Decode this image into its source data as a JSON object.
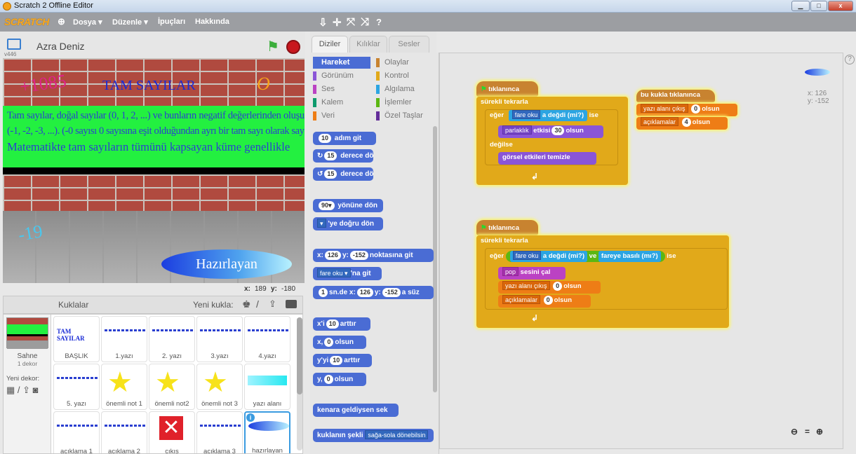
{
  "window": {
    "title": "Scratch 2 Offline Editor",
    "min": "▁",
    "max": "□",
    "close": "x"
  },
  "menubar": {
    "logo": "SCRATCH",
    "globe": "⊕",
    "items": [
      "Dosya ▾",
      "Düzenle ▾",
      "İpuçları",
      "Hakkında"
    ],
    "tools": [
      "⇩",
      "✛",
      "⤧",
      "⤨",
      "?"
    ]
  },
  "stage": {
    "sprite_name": "Azra Deniz",
    "version": "v446",
    "green_flag": "⚑",
    "stop": "●",
    "score": "+1085",
    "title": "TAM SAYILAR",
    "o_letter": "O",
    "text_lines": [
      "Tam sayılar, doğal sayılar (0, 1, 2, ...) ve bunların negatif değerlerinden oluşur",
      "(-1, -2, -3, ...). (-0 sayısı 0 sayısına eşit olduğundan ayrı bir tam sayı olarak sayılmaz)",
      "Matematikte tam sayıların tümünü kapsayan küme genellikle"
    ],
    "minus": "-19",
    "button": "Hazırlayan",
    "x_label": "x:",
    "x_val": "189",
    "y_label": "y:",
    "y_val": "-180"
  },
  "sprites": {
    "header": "Kuklalar",
    "new_sprite": "Yeni kukla:",
    "stage_label": "Sahne",
    "stage_sub": "1 dekor",
    "new_backdrop": "Yeni dekor:",
    "items": [
      "BAŞLIK",
      "1.yazı",
      "2. yazı",
      "3.yazı",
      "4.yazı",
      "5. yazı",
      "önemli not 1",
      "önemli not2",
      "önemli not 3",
      "yazı alanı",
      "açıklama 1",
      "açıklama 2",
      "çıkış",
      "açıklama 3",
      "hazırlayan"
    ]
  },
  "tabs": [
    "Diziler",
    "Kılıklar",
    "Sesler"
  ],
  "categories": {
    "left": [
      "Hareket",
      "Görünüm",
      "Ses",
      "Kalem",
      "Veri"
    ],
    "right": [
      "Olaylar",
      "Kontrol",
      "Algılama",
      "İşlemler",
      "Özel Taşlar"
    ],
    "left_colors": [
      "#4a6cd4",
      "#8a55d7",
      "#bb42c3",
      "#0e9a6c",
      "#ee7d16"
    ],
    "right_colors": [
      "#c88330",
      "#e1a91a",
      "#2ca5e2",
      "#5cb712",
      "#632d99"
    ]
  },
  "palette": {
    "move": "adım git",
    "move_n": "10",
    "turn_r": "derece dön",
    "turn_n": "15",
    "turn_l": "derece dön",
    "turn_l_n": "15",
    "point_dir": "yönüne dön",
    "dir_n": "90▾",
    "point_to": "'ye doğru dön",
    "goto_xy_x": "x:",
    "goto_x": "126",
    "goto_y_lbl": "y:",
    "goto_y": "-152",
    "goto_xy": "noktasına git",
    "goto": "fare oku ▾",
    "goto_suffix": "'na git",
    "glide_n": "1",
    "glide": "sn.de x:",
    "glide_x": "126",
    "glide_y_lbl": "y:",
    "glide_y": "-152",
    "glide_suffix": "a süz",
    "change_x": "x'i",
    "change_x_n": "10",
    "change_x_suffix": "arttır",
    "set_x": "x,",
    "set_x_n": "0",
    "set_x_suffix": "olsun",
    "change_y": "y'yi",
    "change_y_n": "10",
    "change_y_suffix": "arttır",
    "set_y": "y,",
    "set_y_n": "0",
    "set_y_suffix": "olsun",
    "bounce": "kenara geldiysen sek",
    "rotation": "kuklanın şekli",
    "rotation_dd": "sağa-sola dönebilsin"
  },
  "scripts": {
    "s1_hat": "tıklanınca",
    "s1_forever": "sürekli tekrarla",
    "s1_if": "eğer",
    "s1_sensor": "fare oku",
    "s1_touch": "a değdi (mi?)",
    "s1_then": "ise",
    "s1_effect": "parlaklık",
    "s1_effect_mid": "etkisi",
    "s1_effect_n": "30",
    "s1_effect_end": "olsun",
    "s1_else": "değilse",
    "s1_clear": "görsel etkileri temizle",
    "s1_end": "↲",
    "s2_hat": "bu kukla tıklanınca",
    "s2_var1": "yazı alanı çıkış",
    "s2_var1_n": "0",
    "s2_var1_suffix": "olsun",
    "s2_var2": "açıklamalar",
    "s2_var2_n": "4",
    "s2_var2_suffix": "olsun",
    "s3_hat": "tıklanınca",
    "s3_forever": "sürekli tekrarla",
    "s3_if": "eğer",
    "s3_sensor": "fare oku",
    "s3_touch": "a değdi (mi?)",
    "s3_and": "ve",
    "s3_mouse": "fareye basılı (mı?)",
    "s3_then": "ise",
    "s3_sound_dd": "pop",
    "s3_sound": "sesini çal",
    "s3_var1": "yazı alanı çıkış",
    "s3_var1_n": "0",
    "s3_var1_suffix": "olsun",
    "s3_var2": "açıklamalar",
    "s3_var2_n": "0",
    "s3_var2_suffix": "olsun",
    "s3_end": "↲",
    "coord_x": "x: 126",
    "coord_y": "y: -152",
    "zoom_out": "🔍−",
    "zoom_reset": "=",
    "zoom_in": "🔍+",
    "help": "?"
  }
}
